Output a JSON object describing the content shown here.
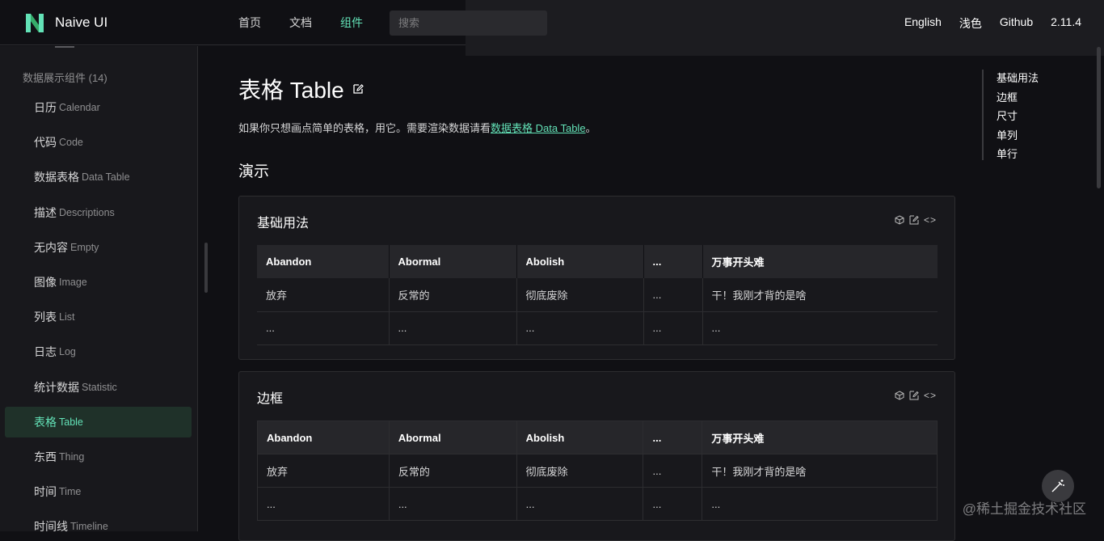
{
  "header": {
    "brand": "Naive UI",
    "nav": [
      "首页",
      "文档",
      "组件"
    ],
    "active_nav": "组件",
    "search_placeholder": "搜索",
    "right": [
      "English",
      "浅色",
      "Github",
      "2.11.4"
    ]
  },
  "sidebar": {
    "group_title": "数据展示组件 (14)",
    "items": [
      {
        "zh": "日历",
        "en": "Calendar"
      },
      {
        "zh": "代码",
        "en": "Code"
      },
      {
        "zh": "数据表格",
        "en": "Data Table"
      },
      {
        "zh": "描述",
        "en": "Descriptions"
      },
      {
        "zh": "无内容",
        "en": "Empty"
      },
      {
        "zh": "图像",
        "en": "Image"
      },
      {
        "zh": "列表",
        "en": "List"
      },
      {
        "zh": "日志",
        "en": "Log"
      },
      {
        "zh": "统计数据",
        "en": "Statistic"
      },
      {
        "zh": "表格",
        "en": "Table"
      },
      {
        "zh": "东西",
        "en": "Thing"
      },
      {
        "zh": "时间",
        "en": "Time"
      },
      {
        "zh": "时间线",
        "en": "Timeline"
      }
    ],
    "selected_index": 9
  },
  "main": {
    "title": "表格 Table",
    "intro_prefix": "如果你只想画点简单的表格，用它。需要渲染数据请看",
    "intro_link": "数据表格 Data Table",
    "intro_suffix": "。",
    "section": "演示",
    "cards": [
      {
        "title": "基础用法",
        "code_label": "<>",
        "headers": [
          "Abandon",
          "Abormal",
          "Abolish",
          "...",
          "万事开头难"
        ],
        "rows": [
          [
            "放弃",
            "反常的",
            "彻底废除",
            "...",
            "干！我刚才背的是啥"
          ],
          [
            "...",
            "...",
            "...",
            "...",
            "..."
          ]
        ]
      },
      {
        "title": "边框",
        "code_label": "<>",
        "headers": [
          "Abandon",
          "Abormal",
          "Abolish",
          "...",
          "万事开头难"
        ],
        "rows": [
          [
            "放弃",
            "反常的",
            "彻底废除",
            "...",
            "干！我刚才背的是啥"
          ],
          [
            "...",
            "...",
            "...",
            "...",
            "..."
          ]
        ]
      }
    ]
  },
  "toc": [
    "基础用法",
    "边框",
    "尺寸",
    "单列",
    "单行"
  ],
  "watermark": "@稀土掘金技术社区",
  "colors": {
    "accent": "#63e2b7",
    "background": "#101014",
    "surface": "#18181c"
  }
}
